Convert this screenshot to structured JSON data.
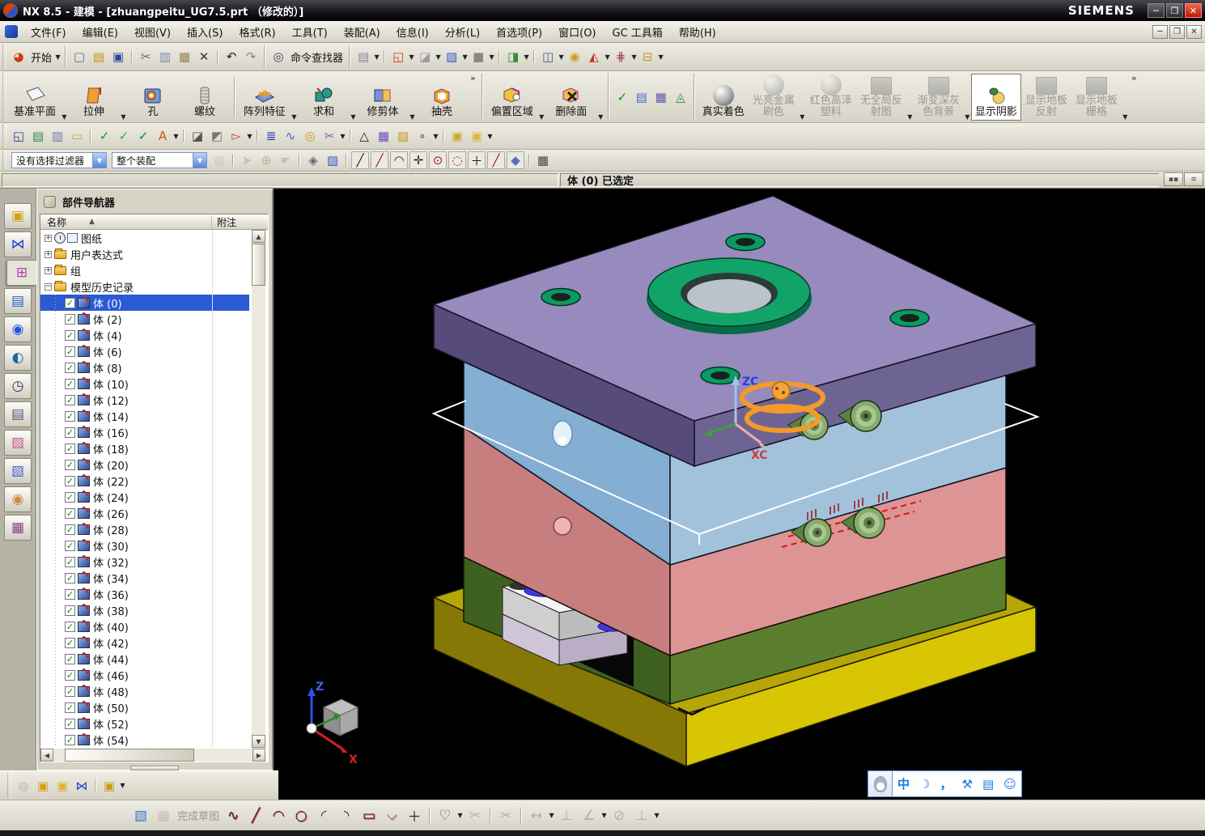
{
  "title_bar": {
    "title": "NX 8.5 - 建模 - [zhuangpeitu_UG7.5.prt （修改的）]",
    "brand": "SIEMENS",
    "minimize": "─",
    "maximize": "❐",
    "close": "✕"
  },
  "menu_bar": {
    "items": [
      "文件(F)",
      "编辑(E)",
      "视图(V)",
      "插入(S)",
      "格式(R)",
      "工具(T)",
      "装配(A)",
      "信息(I)",
      "分析(L)",
      "首选项(P)",
      "窗口(O)",
      "GC 工具箱",
      "帮助(H)"
    ],
    "window_buttons": [
      "─",
      "❐",
      "✕"
    ]
  },
  "toolbar_standard": {
    "start_label": "开始",
    "command_finder_label": "命令查找器",
    "icons_left": [
      {
        "n": "new-file-icon",
        "g": "▢",
        "c": "#5a6a9a"
      },
      {
        "n": "open-folder-icon",
        "g": "▤",
        "c": "#c8920a"
      },
      {
        "n": "save-icon",
        "g": "▣",
        "c": "#2a4a9a"
      },
      {
        "n": "cut-icon",
        "g": "✂",
        "c": "#667",
        "sep": true
      },
      {
        "n": "copy-icon",
        "g": "▥",
        "c": "#7a8ab0"
      },
      {
        "n": "paste-icon",
        "g": "▦",
        "c": "#96824a"
      },
      {
        "n": "delete-icon",
        "g": "✕",
        "c": "#333"
      },
      {
        "n": "undo-icon",
        "g": "↶",
        "c": "#223",
        "sep": true
      },
      {
        "n": "redo-icon",
        "g": "↷",
        "c": "#889"
      }
    ],
    "icons_right": [
      {
        "n": "print-icon",
        "g": "▤",
        "c": "#8a8a96",
        "dd": true
      },
      {
        "n": "screen-split-icon",
        "g": "◱",
        "c": "#d04010",
        "dd": true,
        "sep": true
      },
      {
        "n": "export-icon",
        "g": "◪",
        "c": "#9a9aa8",
        "dd": true
      },
      {
        "n": "view-cube-icon",
        "g": "▧",
        "c": "#3a5ac8",
        "dd": true
      },
      {
        "n": "background-icon",
        "g": "■",
        "c": "#888",
        "dd": true
      },
      {
        "n": "window-icon",
        "g": "◨",
        "c": "#3a8a3a",
        "dd": true,
        "sep": true
      },
      {
        "n": "door-icon",
        "g": "◫",
        "c": "#4a5a9a",
        "dd": true,
        "sep": true
      },
      {
        "n": "role-palette-icon",
        "g": "◉",
        "c": "#c8a020"
      },
      {
        "n": "flags-icon",
        "g": "◭",
        "c": "#c83030",
        "dd": true
      },
      {
        "n": "needles-icon",
        "g": "⋕",
        "c": "#b03060",
        "dd": true
      },
      {
        "n": "ruler-icon",
        "g": "⊟",
        "c": "#c89a20",
        "dd": true
      }
    ]
  },
  "feature_toolbar": {
    "buttons": [
      {
        "label": "基准平面",
        "icon": "datum-plane-icon",
        "dropdown": true
      },
      {
        "label": "拉伸",
        "icon": "extrude-icon",
        "dropdown": true
      },
      {
        "label": "孔",
        "icon": "hole-icon",
        "dropdown": false
      },
      {
        "label": "螺纹",
        "icon": "thread-icon",
        "dropdown": false
      },
      {
        "label": "阵列特征",
        "icon": "pattern-feature-icon",
        "dropdown": true,
        "group": true
      },
      {
        "label": "求和",
        "icon": "unite-icon",
        "dropdown": true
      },
      {
        "label": "修剪体",
        "icon": "trim-body-icon",
        "dropdown": true
      },
      {
        "label": "抽壳",
        "icon": "shell-icon",
        "dropdown": false
      }
    ],
    "synchronous_buttons": [
      {
        "label": "偏置区域",
        "icon": "offset-region-icon",
        "dropdown": true
      },
      {
        "label": "删除面",
        "icon": "delete-face-icon",
        "dropdown": true
      }
    ],
    "check_group_icons": [
      {
        "n": "examine-geometry-icon",
        "g": "✓",
        "c": "#0a9a0a"
      },
      {
        "n": "feature-list-icon",
        "g": "▤",
        "c": "#4a6ac8"
      },
      {
        "n": "spreadsheet-icon",
        "g": "▦",
        "c": "#5a5aa8"
      },
      {
        "n": "datum-csys-icon",
        "g": "◬",
        "c": "#2a8a4a"
      }
    ]
  },
  "render_toolbar": {
    "buttons": [
      {
        "label1": "真实着色",
        "label2": "",
        "enabled": true,
        "active": false,
        "dropdown": false,
        "icon": "true-shading-icon"
      },
      {
        "label1": "光亮金属",
        "label2": "刷色",
        "enabled": false,
        "active": false,
        "dropdown": true,
        "icon": "shiny-metal-icon"
      },
      {
        "label1": "红色高泽",
        "label2": "塑料",
        "enabled": false,
        "active": false,
        "dropdown": false,
        "icon": "red-plastic-icon"
      },
      {
        "label1": "无全局反",
        "label2": "射图",
        "enabled": false,
        "active": false,
        "dropdown": true,
        "icon": "no-reflection-icon"
      },
      {
        "label1": "渐变深灰",
        "label2": "色背景",
        "enabled": false,
        "active": false,
        "dropdown": true,
        "icon": "gray-background-icon"
      },
      {
        "label1": "显示阴影",
        "label2": "",
        "enabled": true,
        "active": true,
        "dropdown": false,
        "icon": "show-shadow-icon"
      },
      {
        "label1": "显示地板",
        "label2": "反射",
        "enabled": false,
        "active": false,
        "dropdown": false,
        "icon": "floor-reflection-icon"
      },
      {
        "label1": "显示地板",
        "label2": "栅格",
        "enabled": false,
        "active": false,
        "dropdown": true,
        "icon": "floor-grid-icon"
      }
    ]
  },
  "view_toolbar": {
    "icons": [
      {
        "n": "fit-view-icon",
        "g": "◱",
        "c": "#2a3a9a"
      },
      {
        "n": "layer-settings-icon",
        "g": "▤",
        "c": "#2a8a4a"
      },
      {
        "n": "layer-category-icon",
        "g": "▥",
        "c": "#6a7ab8"
      },
      {
        "n": "note-icon",
        "g": "▭",
        "c": "#c8a84a"
      },
      {
        "n": "verify-1-icon",
        "g": "✓",
        "c": "#0a9a0a",
        "sep": true
      },
      {
        "n": "verify-2-icon",
        "g": "✓",
        "c": "#3aaa3a"
      },
      {
        "n": "verify-3-icon",
        "g": "✓",
        "c": "#0a8a3a"
      },
      {
        "n": "annotation-icon",
        "g": "A",
        "c": "#c85a10",
        "dd": true
      },
      {
        "n": "section-1-icon",
        "g": "◪",
        "c": "#555",
        "sep": true
      },
      {
        "n": "section-2-icon",
        "g": "◩",
        "c": "#777"
      },
      {
        "n": "select-hand-icon",
        "g": "▻",
        "c": "#c04040",
        "dd": true
      },
      {
        "n": "spring-coil-icon",
        "g": "≣",
        "c": "#2a3ac8",
        "sep": true
      },
      {
        "n": "wire-spring-icon",
        "g": "∿",
        "c": "#4a5ad8"
      },
      {
        "n": "washer-icon",
        "g": "◎",
        "c": "#c8a010"
      },
      {
        "n": "cut-spring-icon",
        "g": "✂",
        "c": "#6a6ab0",
        "dd": true
      },
      {
        "n": "triangle-icon",
        "g": "△",
        "c": "#222",
        "sep": true
      },
      {
        "n": "mesh-table-icon",
        "g": "▦",
        "c": "#6a4ac8"
      },
      {
        "n": "folder-plus-icon",
        "g": "▨",
        "c": "#c89a20"
      },
      {
        "n": "circles-icon",
        "g": "∘",
        "c": "#444",
        "dd": true
      },
      {
        "n": "wave-link-icon",
        "g": "▣",
        "c": "#c8a830",
        "sep": true
      },
      {
        "n": "wave-link2-icon",
        "g": "▣",
        "c": "#d8b840",
        "dd": true
      }
    ]
  },
  "selection_bar": {
    "filter_value": "没有选择过滤器",
    "scope_value": "整个装配",
    "icons": [
      {
        "n": "find-component-icon",
        "g": "◎",
        "c": "#778",
        "dis": true
      },
      {
        "n": "select-arrow-icon",
        "g": "➤",
        "c": "#889",
        "dis": true,
        "sep": true
      },
      {
        "n": "snap-rotate-icon",
        "g": "⊕",
        "c": "#a04040",
        "dis": true
      },
      {
        "n": "snap-hand-icon",
        "g": "☛",
        "c": "#889",
        "dis": true
      },
      {
        "n": "magnet-icon",
        "g": "◈",
        "c": "#667",
        "sep": true
      },
      {
        "n": "book-icon",
        "g": "▧",
        "c": "#3a5ac8"
      },
      {
        "n": "snap-end-icon",
        "g": "╱",
        "c": "#222",
        "box": true,
        "sep": true
      },
      {
        "n": "snap-mid-icon",
        "g": "╱",
        "c": "#a02020",
        "box": true
      },
      {
        "n": "snap-arc-icon",
        "g": "◠",
        "c": "#222",
        "box": true
      },
      {
        "n": "snap-quadrant-icon",
        "g": "✛",
        "c": "#222",
        "box": true
      },
      {
        "n": "snap-center-icon",
        "g": "⊙",
        "c": "#a02020",
        "box": true
      },
      {
        "n": "snap-circle-icon",
        "g": "◌",
        "c": "#a02020",
        "box": true
      },
      {
        "n": "snap-point-icon",
        "g": "＋",
        "c": "#222",
        "box": true
      },
      {
        "n": "snap-line-icon",
        "g": "╱",
        "c": "#a02020",
        "box": true
      },
      {
        "n": "snap-face-icon",
        "g": "◆",
        "c": "#5a6ac8",
        "box": true
      },
      {
        "n": "grid-snap-icon",
        "g": "▦",
        "c": "#444",
        "sep": true
      }
    ]
  },
  "status_bar": {
    "prompt": "体 (0) 已选定"
  },
  "resource_bar": {
    "icons": [
      {
        "n": "assembly-navigator-icon",
        "g": "▣",
        "c": "#d4a017"
      },
      {
        "n": "constraint-navigator-icon",
        "g": "⋈",
        "c": "#2244cc"
      },
      {
        "n": "part-navigator-icon",
        "g": "⊞",
        "c": "#aa44aa",
        "active": true
      },
      {
        "n": "reuse-library-icon",
        "g": "▤",
        "c": "#2266cc"
      },
      {
        "n": "hd3d-tools-icon",
        "g": "◉",
        "c": "#2255dd"
      },
      {
        "n": "web-browser-icon",
        "g": "◐",
        "c": "#2266aa"
      },
      {
        "n": "history-icon",
        "g": "◷",
        "c": "#336"
      },
      {
        "n": "process-studio-icon",
        "g": "▤",
        "c": "#557"
      },
      {
        "n": "roles-icon",
        "g": "▨",
        "c": "#cc5588"
      },
      {
        "n": "visualization-icon",
        "g": "▧",
        "c": "#4466cc"
      },
      {
        "n": "collaboration-icon",
        "g": "◉",
        "c": "#cc8844"
      },
      {
        "n": "materials-icon",
        "g": "▦",
        "c": "#884488"
      }
    ]
  },
  "navigator": {
    "title": "部件导航器",
    "col_name": "名称",
    "col_note": "附注",
    "sort_icon": "▲",
    "folders": [
      {
        "label": "图纸",
        "expander": "+",
        "kind": "drawing"
      },
      {
        "label": "用户表达式",
        "expander": "+",
        "kind": "folder"
      },
      {
        "label": "组",
        "expander": "+",
        "kind": "folder"
      },
      {
        "label": "模型历史记录",
        "expander": "−",
        "kind": "folder"
      }
    ],
    "bodies": [
      {
        "label": "体 (0)",
        "selected": true
      },
      {
        "label": "体 (2)"
      },
      {
        "label": "体 (4)"
      },
      {
        "label": "体 (6)"
      },
      {
        "label": "体 (8)"
      },
      {
        "label": "体 (10)"
      },
      {
        "label": "体 (12)"
      },
      {
        "label": "体 (14)"
      },
      {
        "label": "体 (16)"
      },
      {
        "label": "体 (18)"
      },
      {
        "label": "体 (20)"
      },
      {
        "label": "体 (22)"
      },
      {
        "label": "体 (24)"
      },
      {
        "label": "体 (26)"
      },
      {
        "label": "体 (28)"
      },
      {
        "label": "体 (30)"
      },
      {
        "label": "体 (32)"
      },
      {
        "label": "体 (34)"
      },
      {
        "label": "体 (36)"
      },
      {
        "label": "体 (38)"
      },
      {
        "label": "体 (40)"
      },
      {
        "label": "体 (42)"
      },
      {
        "label": "体 (44)"
      },
      {
        "label": "体 (46)"
      },
      {
        "label": "体 (48)"
      },
      {
        "label": "体 (50)"
      },
      {
        "label": "体 (52)"
      },
      {
        "label": "体 (54)"
      }
    ]
  },
  "assembly_toolbar": {
    "icons": [
      {
        "n": "find-in-assembly-icon",
        "g": "◍",
        "c": "#778",
        "dis": true
      },
      {
        "n": "add-component-icon",
        "g": "▣",
        "c": "#d4a017"
      },
      {
        "n": "move-component-icon",
        "g": "▣",
        "c": "#e0b030"
      },
      {
        "n": "mirror-assembly-icon",
        "g": "⋈",
        "c": "#2244cc"
      },
      {
        "n": "component-group-icon",
        "g": "▣",
        "c": "#c89a20",
        "dd": true,
        "sep": true
      }
    ]
  },
  "sketch_toolbar": {
    "finish_label": "完成草图",
    "icons_pre": [
      {
        "n": "sketch-task-icon",
        "g": "▧",
        "c": "#3a7ac8"
      },
      {
        "n": "sketch-grid-icon",
        "g": "▦",
        "c": "#888",
        "dis": true
      }
    ],
    "icons_post": [
      {
        "n": "profile-icon",
        "g": "∿",
        "c": "#222",
        "red": true
      },
      {
        "n": "line-icon",
        "g": "╱",
        "c": "#222",
        "red": true
      },
      {
        "n": "arc-icon",
        "g": "◠",
        "c": "#222",
        "red": true
      },
      {
        "n": "circle-icon",
        "g": "○",
        "c": "#222",
        "red": true
      },
      {
        "n": "fillet-icon",
        "g": "◜",
        "c": "#222"
      },
      {
        "n": "chamfer-icon",
        "g": "◝",
        "c": "#222"
      },
      {
        "n": "rectangle-icon",
        "g": "▭",
        "c": "#222",
        "red": true
      },
      {
        "n": "polyline-icon",
        "g": "⌵",
        "c": "#555",
        "red": true
      },
      {
        "n": "point-icon",
        "g": "＋",
        "c": "#222"
      },
      {
        "n": "offset-curve-icon",
        "g": "♡",
        "c": "#555",
        "dd": true,
        "sep": true
      },
      {
        "n": "quick-trim-icon",
        "g": "✂",
        "c": "#556",
        "dis": true
      },
      {
        "n": "quick-extend-icon",
        "g": "✂",
        "c": "#556",
        "dis": true,
        "sep": true
      },
      {
        "n": "rapid-dimension-icon",
        "g": "↔",
        "c": "#556",
        "dis": true,
        "dd": true,
        "sep": true
      },
      {
        "n": "perpendicular-constraint-icon",
        "g": "⊥",
        "c": "#556",
        "dis": true
      },
      {
        "n": "angle-constraint-icon",
        "g": "∠",
        "c": "#556",
        "dis": true,
        "dd": true
      },
      {
        "n": "no-constraint-icon",
        "g": "⊘",
        "c": "#556",
        "dis": true
      },
      {
        "n": "auto-constrain-icon",
        "g": "⊥",
        "c": "#556",
        "dis": true,
        "dd": true
      }
    ]
  },
  "ime_bar": {
    "lang_label": "中",
    "icons": [
      {
        "n": "moon-icon",
        "g": "☽"
      },
      {
        "n": "punctuation-icon",
        "g": "，"
      },
      {
        "n": "wrench-icon",
        "g": "⚒"
      },
      {
        "n": "clipboard-icon",
        "g": "▤"
      },
      {
        "n": "smiley-icon",
        "g": "☺"
      }
    ]
  },
  "viewport": {
    "wcs": {
      "z_label": "ZC",
      "x_label": "XC"
    },
    "view_triad": {
      "z_label": "Z",
      "x_label": "X"
    }
  }
}
